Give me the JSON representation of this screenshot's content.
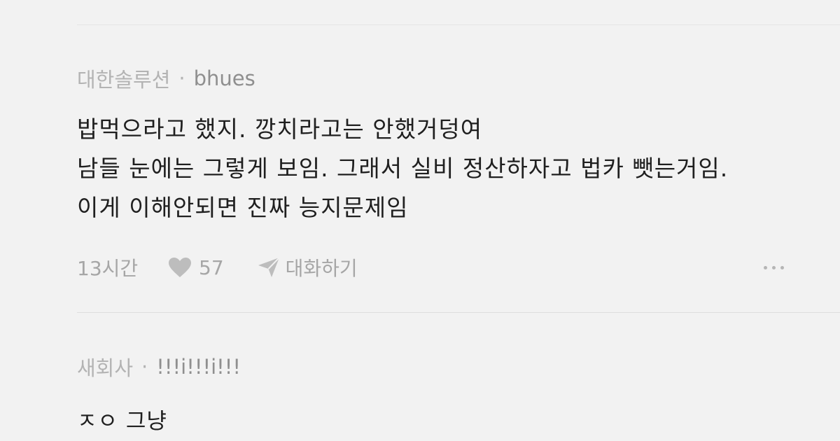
{
  "comments": [
    {
      "company": "대한솔루션",
      "separator": "·",
      "author": "bhues",
      "lines": [
        "밥먹으라고 했지. 깡치라고는 안했거덩여",
        "남들 눈에는 그렇게 보임. 그래서 실비 정산하자고 법카 뺏는거임.",
        "이게 이해안되면 진짜 능지문제임"
      ],
      "time": "13시간",
      "likes": "57",
      "reply_label": "대화하기",
      "like_icon": "heart-icon",
      "reply_icon": "send-icon",
      "more_icon": "more-dots-icon"
    },
    {
      "company": "새회사",
      "separator": "·",
      "author": "!!!i!!!i!!!",
      "lines": [
        "ㅈㅇ 그냥"
      ]
    }
  ],
  "colors": {
    "background": "#f2f2f2",
    "text": "#1f1f1f",
    "meta": "#a0a0a0",
    "icon": "#b8b8b8"
  }
}
